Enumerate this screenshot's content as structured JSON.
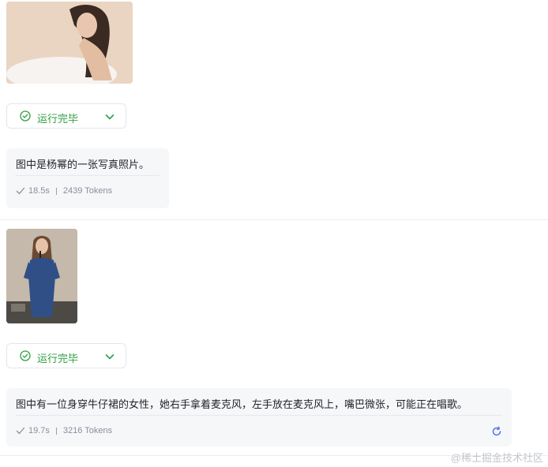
{
  "messages": [
    {
      "status_label": "运行完毕",
      "answer_text": "图中是杨幂的一张写真照片。",
      "duration": "18.5s",
      "tokens": "2439 Tokens"
    },
    {
      "status_label": "运行完毕",
      "answer_text": "图中有一位身穿牛仔裙的女性，她右手拿着麦克风，左手放在麦克风上，嘴巴微张，可能正在唱歌。",
      "duration": "19.7s",
      "tokens": "3216 Tokens"
    }
  ],
  "watermark": "@稀土掘金技术社区",
  "colors": {
    "success": "#2f9e44",
    "accent": "#4c6ef5",
    "muted": "#8a8f99"
  }
}
